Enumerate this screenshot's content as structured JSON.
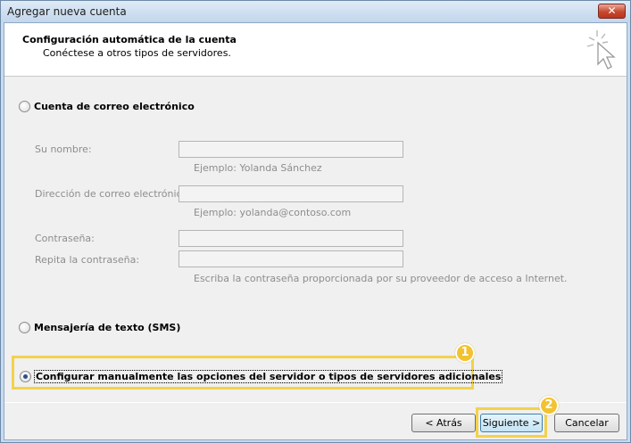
{
  "window": {
    "title": "Agregar nueva cuenta",
    "close_glyph": "✕"
  },
  "header": {
    "title": "Configuración automática de la cuenta",
    "subtitle": "Conéctese a otros tipos de servidores."
  },
  "options": {
    "email": {
      "label": "Cuenta de correo electrónico",
      "checked": false
    },
    "sms": {
      "label": "Mensajería de texto (SMS)",
      "checked": false
    },
    "manual": {
      "label": "Configurar manualmente las opciones del servidor o tipos de servidores adicionales",
      "checked": true
    }
  },
  "form": {
    "name": {
      "label": "Su nombre:",
      "value": "",
      "hint": "Ejemplo: Yolanda Sánchez"
    },
    "email": {
      "label": "Dirección de correo electrónico:",
      "value": "",
      "hint": "Ejemplo: yolanda@contoso.com"
    },
    "password": {
      "label": "Contraseña:",
      "value": ""
    },
    "password_repeat": {
      "label": "Repita la contraseña:",
      "value": "",
      "hint": "Escriba la contraseña proporcionada por su proveedor de acceso a Internet."
    }
  },
  "annotations": {
    "badge1": "1",
    "badge2": "2",
    "highlight_color": "#f2d24a"
  },
  "buttons": {
    "back": "< Atrás",
    "next": "Siguiente >",
    "cancel": "Cancelar"
  }
}
